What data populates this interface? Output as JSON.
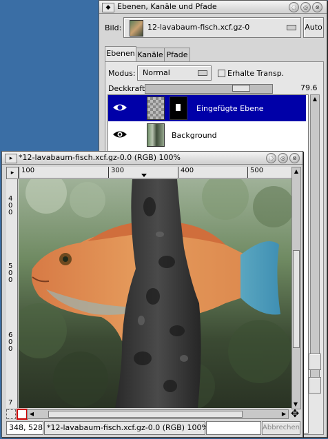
{
  "desktop": {
    "background": "#3a6ea5"
  },
  "layers_dialog": {
    "title": "Ebenen, Kanäle und Pfade",
    "menu_glyph": "◆",
    "controls": [
      "◌",
      "◎",
      "⊗"
    ],
    "image_label": "Bild:",
    "image_value": "12-lavabaum-fisch.xcf.gz-0",
    "auto_label": "Auto",
    "tabs": [
      {
        "label": "Ebenen",
        "active": true
      },
      {
        "label": "Kanäle",
        "active": false
      },
      {
        "label": "Pfade",
        "active": false
      }
    ],
    "mode_label": "Modus:",
    "mode_value": "Normal",
    "keep_transp_label": "Erhalte Transp.",
    "keep_transp_checked": false,
    "opacity_label": "Deckkraft:",
    "opacity_value": "79.6",
    "opacity_fraction": 0.796,
    "layers": [
      {
        "name": "Eingefügte Ebene",
        "selected": true,
        "visible": true
      },
      {
        "name": "Background",
        "selected": false,
        "visible": true
      }
    ],
    "selection_color": "#0000a8"
  },
  "image_window": {
    "title": "*12-lavabaum-fisch.xcf.gz-0.0 (RGB) 100%",
    "menu_glyph": "▸",
    "controls": [
      "◌",
      "◎",
      "⊗"
    ],
    "ruler_h_labels": [
      "100",
      "300",
      "400",
      "500"
    ],
    "ruler_v_labels": [
      "4\n0\n0",
      "5\n0\n0",
      "6\n0\n0",
      "7"
    ],
    "coords": "348, 528",
    "status": "*12-lavabaum-fisch.xcf.gz-0.0 (RGB) 100%",
    "cancel_label": "Abbrechen",
    "nav_glyph": "✥"
  }
}
